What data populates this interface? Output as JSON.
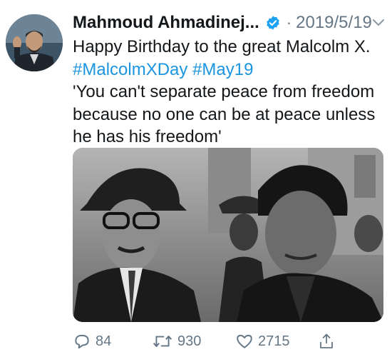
{
  "tweet": {
    "author_name": "Mahmoud Ahmadinej...",
    "verified": true,
    "separator": "·",
    "date": "2019/5/19",
    "text_line1": "Happy Birthday to the great Malcolm X.",
    "hashtag1": "#MalcolmXDay",
    "hashtag2": "#May19",
    "quote_line1": "'You can't separate peace from freedom",
    "quote_line2": "because no one can be at peace unless",
    "quote_line3": "he has his freedom'"
  },
  "actions": {
    "reply_count": "84",
    "retweet_count": "930",
    "like_count": "2715"
  },
  "colors": {
    "link": "#1b95e0",
    "secondary": "#657786",
    "verified_badge": "#1da1f2"
  },
  "icons": {
    "verified": "verified-badge-icon",
    "more": "chevron-down-icon",
    "reply": "speech-bubble-icon",
    "retweet": "retweet-arrows-icon",
    "like": "heart-icon",
    "share": "share-upload-icon"
  }
}
